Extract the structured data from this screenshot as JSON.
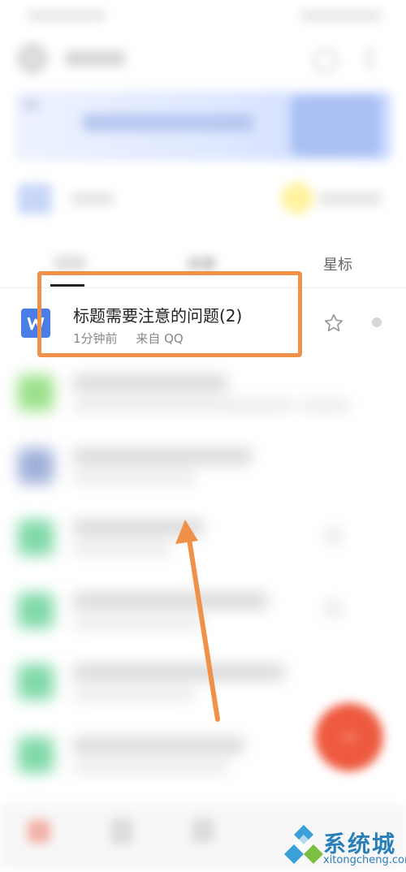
{
  "tabs": {
    "recent": "",
    "shared": "共享",
    "starred": "星标"
  },
  "file": {
    "title": "标题需要注意的问题(2)",
    "time": "1分钟前",
    "source": "来自 QQ",
    "icon_letter": "W"
  },
  "watermark": {
    "brand": "系统城",
    "url": "xitongcheng.com"
  },
  "colors": {
    "highlight": "#f0914a",
    "fab": "#ee5a3f",
    "file_icon": "#4a7de8",
    "watermark": "#2a7fb8"
  }
}
